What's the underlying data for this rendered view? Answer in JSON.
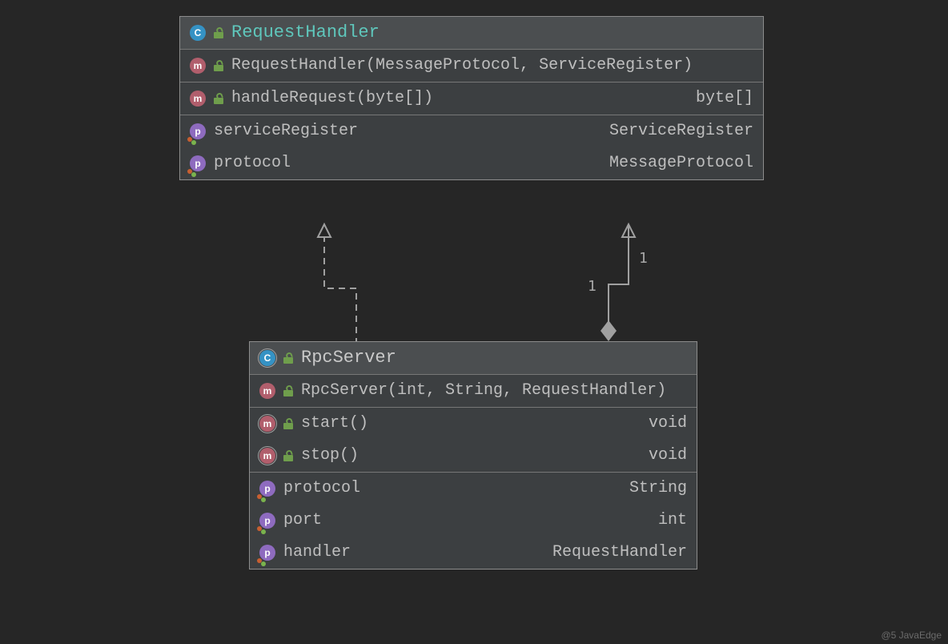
{
  "watermark": "@5 JavaEdge",
  "cardinality": {
    "end1": "1",
    "end2": "1"
  },
  "classes": {
    "requestHandler": {
      "name": "RequestHandler",
      "members": [
        {
          "kind": "method",
          "sig": "RequestHandler(MessageProtocol, ServiceRegister)",
          "ret": ""
        },
        {
          "kind": "method",
          "sig": "handleRequest(byte[])",
          "ret": "byte[]"
        },
        {
          "kind": "property",
          "sig": "serviceRegister",
          "ret": "ServiceRegister"
        },
        {
          "kind": "property",
          "sig": "protocol",
          "ret": "MessageProtocol"
        }
      ]
    },
    "rpcServer": {
      "name": "RpcServer",
      "members": [
        {
          "kind": "method",
          "sig": "RpcServer(int, String, RequestHandler)",
          "ret": ""
        },
        {
          "kind": "method",
          "sig": "start()",
          "ret": "void"
        },
        {
          "kind": "method",
          "sig": "stop()",
          "ret": "void"
        },
        {
          "kind": "property",
          "sig": "protocol",
          "ret": "String"
        },
        {
          "kind": "property",
          "sig": "port",
          "ret": "int"
        },
        {
          "kind": "property",
          "sig": "handler",
          "ret": "RequestHandler"
        }
      ]
    }
  }
}
